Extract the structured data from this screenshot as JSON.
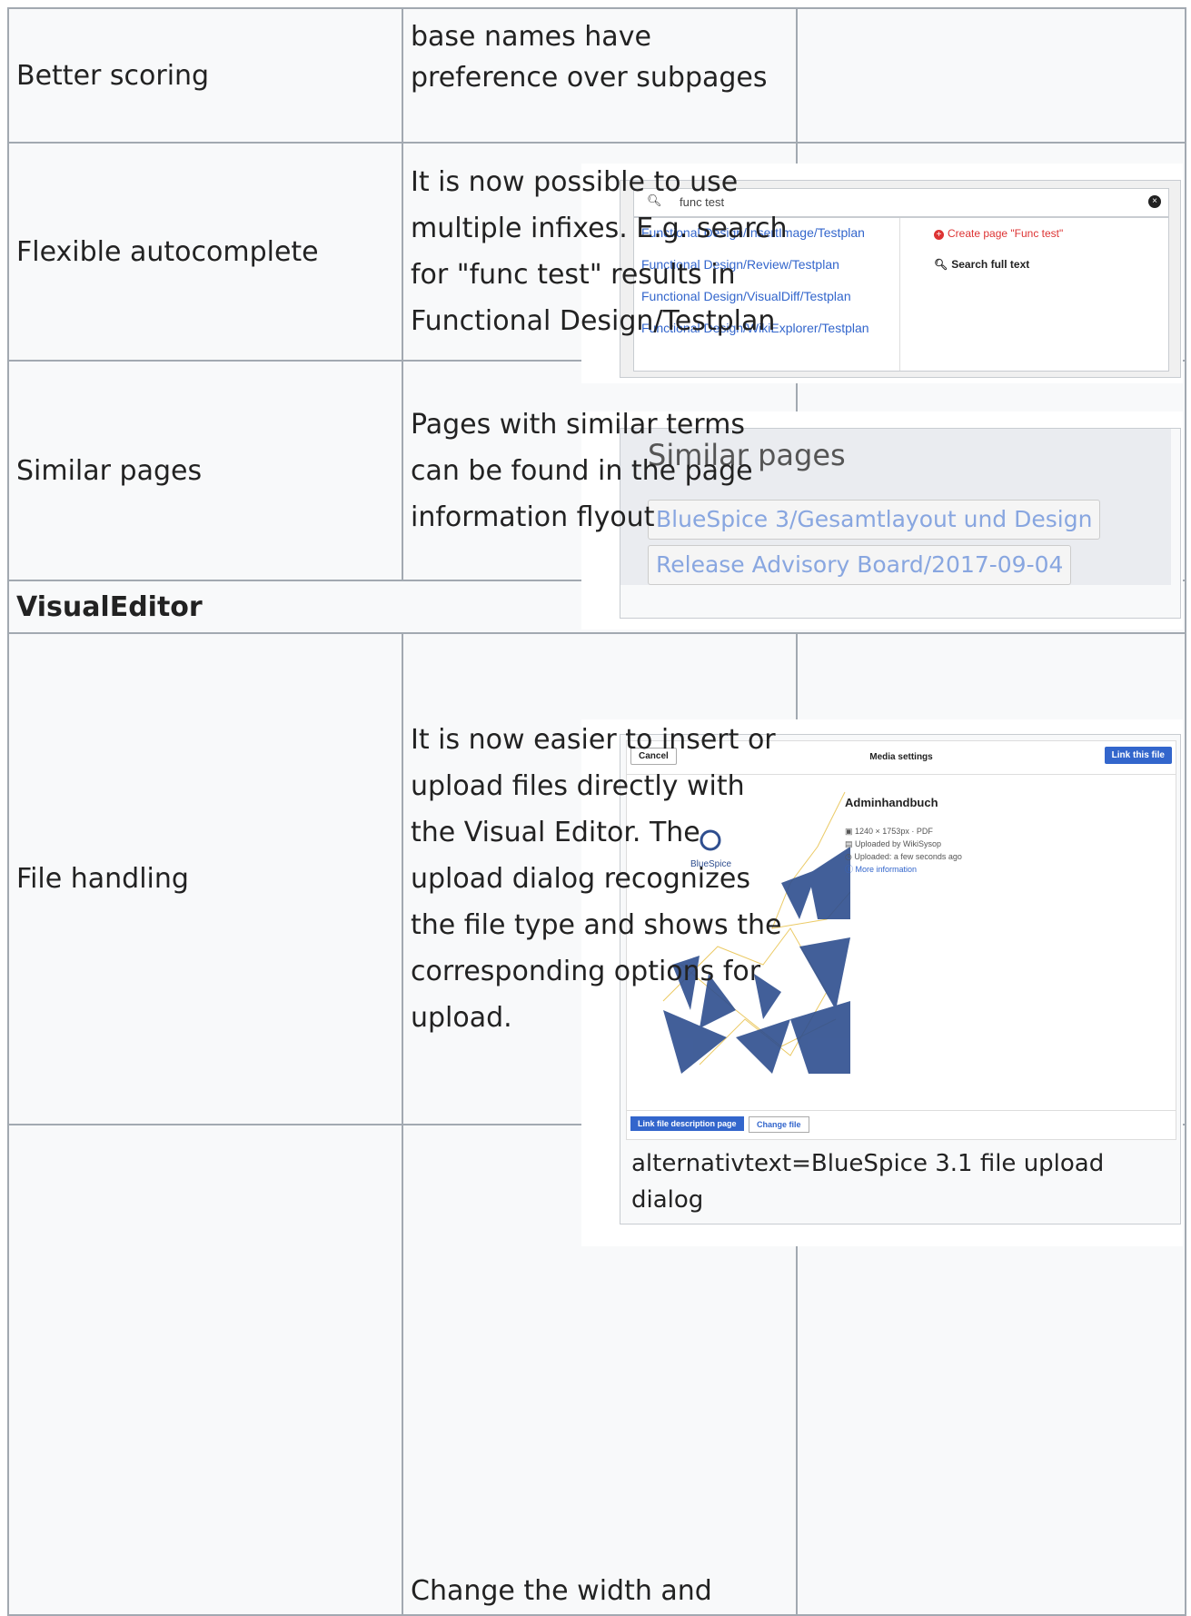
{
  "rows": [
    {
      "feature": "Better scoring",
      "description": "base names have preference over subpages"
    },
    {
      "feature": "Flexible autocomplete",
      "description": "It is now possible to use multiple infixes. E.g. search for \"func test\" results in Functional Design/Testplan"
    },
    {
      "feature": "Similar pages",
      "description": "Pages with similar terms can be found in the page information flyout"
    },
    {
      "section": "VisualEditor"
    },
    {
      "feature": "File handling",
      "description": "It is now easier to insert or upload files directly with the Visual Editor. The upload dialog recognizes the file type and shows the corresponding options for upload."
    },
    {
      "feature": "",
      "description": "Change the width and"
    }
  ],
  "autocomplete": {
    "query": "func test",
    "results": [
      "Functional Design/InsertImage/Testplan",
      "Functional Design/Review/Testplan",
      "Functional Design/VisualDiff/Testplan",
      "Functional Design/WikiExplorer/Testplan"
    ],
    "create_page": "Create page \"Func test\"",
    "search_full": "Search full text"
  },
  "similar": {
    "title": "Similar pages",
    "links": [
      "BlueSpice 3/Gesamtlayout und Design",
      "Release Advisory Board/2017-09-04"
    ]
  },
  "media": {
    "cancel": "Cancel",
    "title": "Media settings",
    "link_file": "Link this file",
    "file_name": "Adminhandbuch",
    "meta": [
      "1240 × 1753px · PDF",
      "Uploaded by WikiSysop",
      "Uploaded: a few seconds ago",
      "More information"
    ],
    "logo_text": "BlueSpice",
    "btn_desc": "Link file description page",
    "btn_change": "Change file",
    "caption": "alternativtext=BlueSpice 3.1 file upload dialog"
  },
  "colors": {
    "link": "#3366cc",
    "border": "#a2a9b1",
    "primary": "#3366cc",
    "destructive": "#d33"
  }
}
